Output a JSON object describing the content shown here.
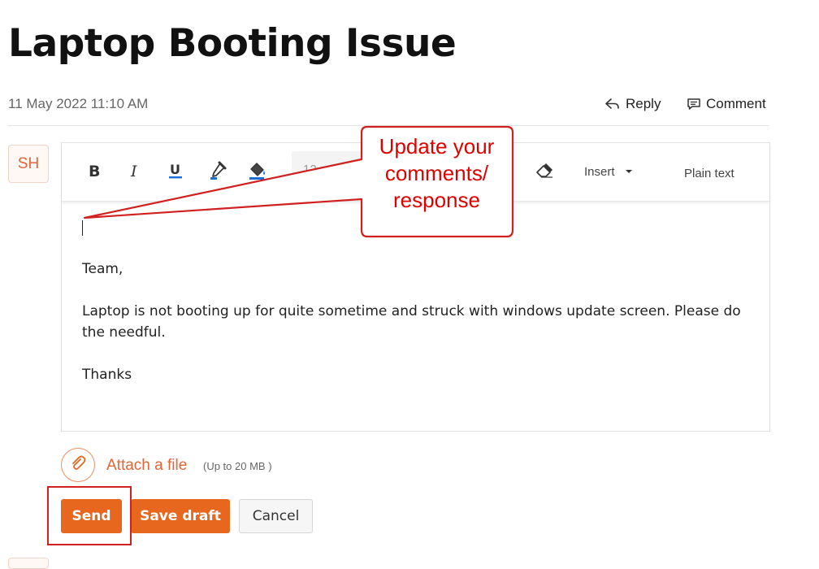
{
  "ticket": {
    "title": "Laptop Booting Issue",
    "timestamp": "11 May 2022 11:10 AM"
  },
  "actions": {
    "reply_label": "Reply",
    "comment_label": "Comment"
  },
  "author": {
    "initials": "SH"
  },
  "toolbar": {
    "font_size_value": "12",
    "insert_label": "Insert",
    "plain_text_label": "Plain text"
  },
  "message": {
    "lines": [
      "Team,",
      "Laptop is not booting up for quite sometime and struck with windows update screen. Please do the needful.",
      "Thanks"
    ]
  },
  "attachment": {
    "link_label": "Attach a file",
    "limit_label": "(Up to 20 MB )"
  },
  "buttons": {
    "send_label": "Send",
    "save_draft_label": "Save draft",
    "cancel_label": "Cancel"
  },
  "annotation": {
    "callout_lines": [
      "Update your",
      "comments/",
      "response"
    ]
  },
  "colors": {
    "accent": "#e8671e",
    "annotation_red": "#d02020",
    "avatar_text": "#e0663a"
  },
  "icons": {
    "reply": "reply-icon",
    "comment": "comment-icon",
    "bold": "bold-icon",
    "italic": "italic-icon",
    "underline": "underline-icon",
    "text_color": "eyedropper-icon",
    "background_color": "paint-bucket-icon",
    "clear_format": "eraser-icon",
    "attach": "paperclip-icon"
  }
}
